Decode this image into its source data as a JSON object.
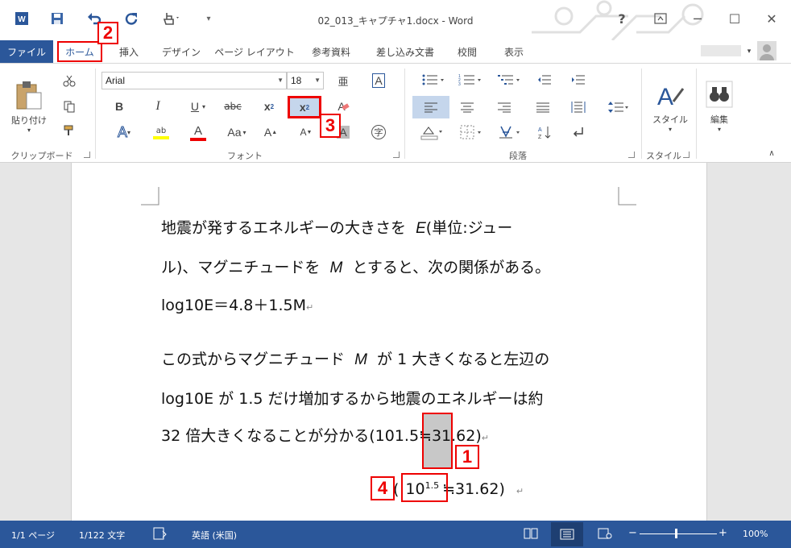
{
  "window": {
    "title": "02_013_キャプチャ1.docx - Word",
    "help": "?",
    "minimize": "─",
    "maximize": "☐",
    "close": "✕"
  },
  "quick_access": {
    "app_icon": "word-icon",
    "save": "save-icon",
    "undo": "undo-icon",
    "redo": "redo-icon",
    "touch": "touch-mode-icon",
    "customize": "customize-icon"
  },
  "tabs": [
    "ファイル",
    "ホーム",
    "挿入",
    "デザイン",
    "ページ レイアウト",
    "参考資料",
    "差し込み文書",
    "校閲",
    "表示"
  ],
  "ribbon": {
    "clipboard": {
      "paste": "貼り付け",
      "label": "クリップボード"
    },
    "font": {
      "font_name": "Arial",
      "font_size": "18",
      "bold": "B",
      "italic": "I",
      "underline": "U",
      "strikethrough": "abc",
      "subscript": "x",
      "subscript_mark": "2",
      "superscript": "x",
      "superscript_mark": "2",
      "grow": "A",
      "shrink": "A",
      "change_case": "Aa",
      "text_effect": "A",
      "highlight": "ab",
      "font_color": "A",
      "phonetic": "亜",
      "enclose": "字",
      "clear": "A",
      "char_border": "A",
      "char_shading": "A",
      "label": "フォント"
    },
    "paragraph": {
      "label": "段落"
    },
    "styles": {
      "button": "スタイル",
      "label": "スタイル"
    },
    "editing": {
      "button": "編集"
    }
  },
  "document": {
    "line1_a": "地震が発するエネルギーの大きさを",
    "line1_var": "E",
    "line1_b": "(単位:ジュー",
    "line2_a": "ル)、マグニチュードを",
    "line2_var": "M",
    "line2_b": "とすると、次の関係がある。",
    "line3": "log10E＝4.8＋1.5M",
    "line4_a": "この式からマグニチュード",
    "line4_var": "M",
    "line4_b": "が 1 大きくなると左辺の",
    "line5": "log10E が 1.5 だけ増加するから地震のエネルギーは約",
    "line6_a": "32 倍大きくなることが分かる(10",
    "line6_sel": "1.5",
    "line6_b": "≒31.62)",
    "line7_open": "(",
    "line7_base": "10",
    "line7_sup": "1.5",
    "line7_rest": "≒31.62)",
    "para_mark": "↵"
  },
  "callouts": {
    "c1": "1",
    "c2": "2",
    "c3": "3",
    "c4": "4"
  },
  "status": {
    "page": "1/1 ページ",
    "words": "1/122 文字",
    "language": "英語 (米国)",
    "zoom": "100%",
    "zoom_minus": "−",
    "zoom_plus": "+"
  },
  "colors": {
    "brand": "#2b579a",
    "callout": "#e00000",
    "highlight": "#c8c8c8"
  }
}
